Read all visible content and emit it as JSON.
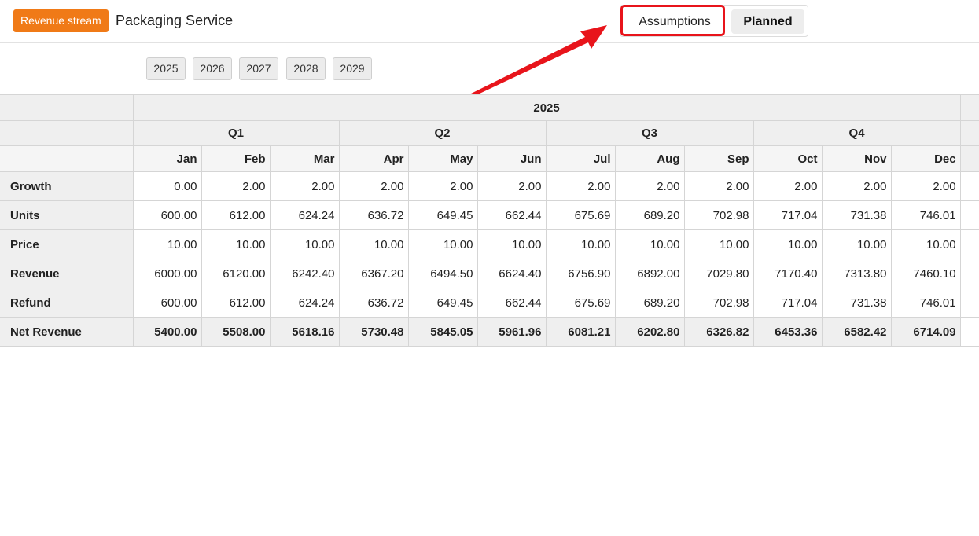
{
  "header": {
    "badge_label": "Revenue stream",
    "title": "Packaging Service",
    "toggle": {
      "assumptions_label": "Assumptions",
      "planned_label": "Planned",
      "selected": "Planned"
    }
  },
  "year_tabs": [
    "2025",
    "2026",
    "2027",
    "2028",
    "2029"
  ],
  "table": {
    "year": "2025",
    "quarters": [
      "Q1",
      "Q2",
      "Q3",
      "Q4"
    ],
    "months": [
      "Jan",
      "Feb",
      "Mar",
      "Apr",
      "May",
      "Jun",
      "Jul",
      "Aug",
      "Sep",
      "Oct",
      "Nov",
      "Dec"
    ],
    "rows": [
      {
        "label": "Growth",
        "values": [
          "0.00",
          "2.00",
          "2.00",
          "2.00",
          "2.00",
          "2.00",
          "2.00",
          "2.00",
          "2.00",
          "2.00",
          "2.00",
          "2.00"
        ]
      },
      {
        "label": "Units",
        "values": [
          "600.00",
          "612.00",
          "624.24",
          "636.72",
          "649.45",
          "662.44",
          "675.69",
          "689.20",
          "702.98",
          "717.04",
          "731.38",
          "746.01"
        ]
      },
      {
        "label": "Price",
        "values": [
          "10.00",
          "10.00",
          "10.00",
          "10.00",
          "10.00",
          "10.00",
          "10.00",
          "10.00",
          "10.00",
          "10.00",
          "10.00",
          "10.00"
        ]
      },
      {
        "label": "Revenue",
        "values": [
          "6000.00",
          "6120.00",
          "6242.40",
          "6367.20",
          "6494.50",
          "6624.40",
          "6756.90",
          "6892.00",
          "7029.80",
          "7170.40",
          "7313.80",
          "7460.10"
        ]
      },
      {
        "label": "Refund",
        "values": [
          "600.00",
          "612.00",
          "624.24",
          "636.72",
          "649.45",
          "662.44",
          "675.69",
          "689.20",
          "702.98",
          "717.04",
          "731.38",
          "746.01"
        ]
      },
      {
        "label": "Net Revenue",
        "values": [
          "5400.00",
          "5508.00",
          "5618.16",
          "5730.48",
          "5845.05",
          "5961.96",
          "6081.21",
          "6202.80",
          "6326.82",
          "6453.36",
          "6582.42",
          "6714.09"
        ]
      }
    ]
  },
  "colors": {
    "badge": "#f07a17",
    "highlight": "#e8141b"
  }
}
